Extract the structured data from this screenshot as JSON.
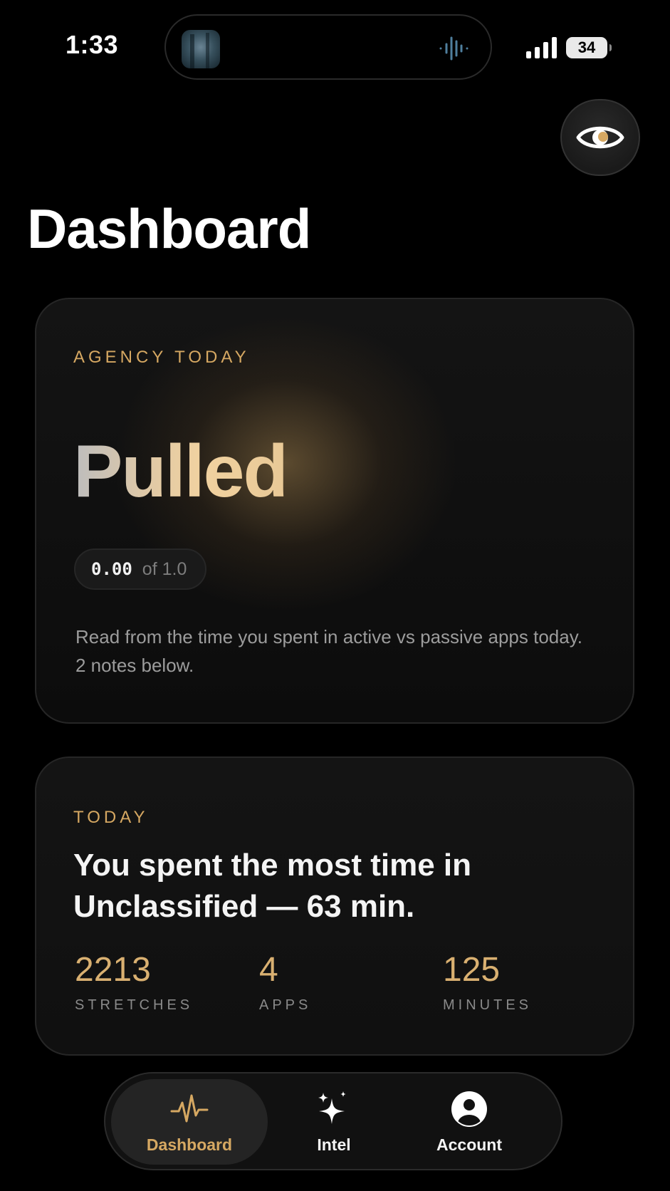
{
  "status_bar": {
    "time": "1:33",
    "battery": "34"
  },
  "header": {
    "title": "Dashboard"
  },
  "agency_card": {
    "eyebrow": "AGENCY TODAY",
    "value": "Pulled",
    "score": "0.00",
    "score_of": "of 1.0",
    "description": "Read from the time you spent in active vs passive apps today. 2 notes below."
  },
  "today_card": {
    "eyebrow": "TODAY",
    "headline": "You spent the most time in Unclassified — 63 min.",
    "stats": [
      {
        "value": "2213",
        "label": "STRETCHES"
      },
      {
        "value": "4",
        "label": "APPS"
      },
      {
        "value": "125",
        "label": "MINUTES"
      }
    ]
  },
  "tab_bar": {
    "tabs": [
      {
        "label": "Dashboard",
        "icon": "pulse-icon",
        "active": true
      },
      {
        "label": "Intel",
        "icon": "sparkles-icon",
        "active": false
      },
      {
        "label": "Account",
        "icon": "person-circle-icon",
        "active": false
      }
    ]
  },
  "colors": {
    "accent": "#d6a862",
    "background": "#000000",
    "card": "#121212",
    "muted_text": "#9c9c9c"
  }
}
